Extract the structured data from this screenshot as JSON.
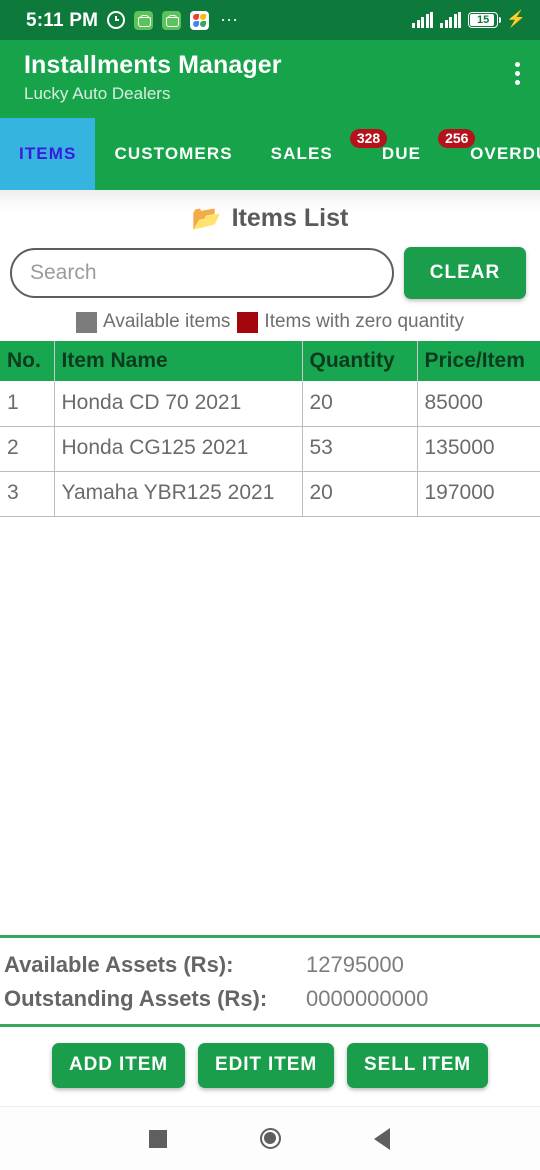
{
  "status_bar": {
    "time": "5:11 PM",
    "icons": [
      "alarm-icon",
      "app-green-icon",
      "app-green-icon",
      "google-photos-icon",
      "more-dots-icon"
    ],
    "battery_level": "15",
    "charging": true
  },
  "app_bar": {
    "title": "Installments Manager",
    "subtitle": "Lucky Auto Dealers",
    "overflow_menu": "overflow-menu-icon"
  },
  "tabs": [
    {
      "label": "ITEMS",
      "active": true,
      "badge": null
    },
    {
      "label": "CUSTOMERS",
      "active": false,
      "badge": null
    },
    {
      "label": "SALES",
      "active": false,
      "badge": null
    },
    {
      "label": "DUE",
      "active": false,
      "badge": "328"
    },
    {
      "label": "OVERDUE",
      "active": false,
      "badge": "256"
    }
  ],
  "main": {
    "list_title": "Items List",
    "folder_icon": "📂",
    "search": {
      "value": "",
      "placeholder": "Search"
    },
    "clear_label": "CLEAR",
    "legend": [
      {
        "label": "Available items",
        "color": "#7C7C7C"
      },
      {
        "label": "Items with zero quantity",
        "color": "#A4060D"
      }
    ],
    "table": {
      "headers": [
        "No.",
        "Item Name",
        "Quantity",
        "Price/Item"
      ],
      "rows": [
        {
          "no": "1",
          "name": "Honda CD 70 2021",
          "quantity": "20",
          "price": "85000"
        },
        {
          "no": "2",
          "name": "Honda CG125 2021",
          "quantity": "53",
          "price": "135000"
        },
        {
          "no": "3",
          "name": "Yamaha YBR125 2021",
          "quantity": "20",
          "price": "197000"
        }
      ]
    }
  },
  "totals": {
    "available_label": "Available Assets (Rs):",
    "available_value": "12795000",
    "outstanding_label": "Outstanding Assets (Rs):",
    "outstanding_value": "0000000000"
  },
  "actions": [
    {
      "label": "ADD ITEM"
    },
    {
      "label": "EDIT ITEM"
    },
    {
      "label": "SELL ITEM"
    }
  ],
  "nav_bar": {
    "recents": "square-recents-icon",
    "home": "circle-home-icon",
    "back": "triangle-back-icon"
  },
  "colors": {
    "primary_green": "#16A34A",
    "status_green": "#0D7A3C",
    "active_tab": "#36B4E0",
    "active_tab_text": "#3A1ADE",
    "badge_red": "#B5121B",
    "button_green": "#1B9E4B"
  }
}
